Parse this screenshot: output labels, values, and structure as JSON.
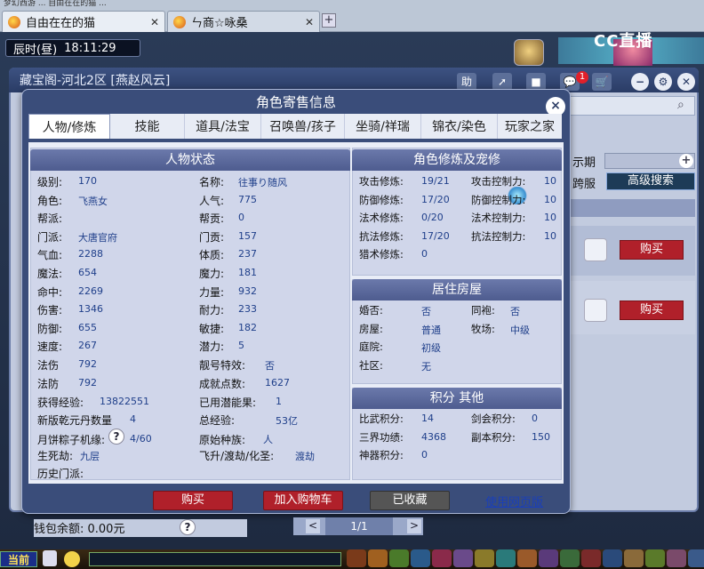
{
  "browser": {
    "top_title": "梦幻西游 ... 自由在在的猫 ...",
    "tabs": [
      {
        "label": "自由在在的猫"
      },
      {
        "label": "ㄣ商☆咏桑"
      }
    ],
    "new_tab": "+"
  },
  "game": {
    "time": "辰时(昼)",
    "clock": "18:11:29",
    "cc_logo": "CC直播"
  },
  "outer_window": {
    "title": "藏宝阁-河北2区 [燕赵风云]",
    "help_btn": "助",
    "badge_count": "1",
    "expiry_label": "示期",
    "plus": "+",
    "cross_server_label": "跨服",
    "advanced_search": "高级搜索",
    "buy_label": "购买",
    "search_icon": "search-icon"
  },
  "modal": {
    "title": "角色寄售信息",
    "close": "×",
    "tabs": [
      "人物/修炼",
      "技能",
      "道具/法宝",
      "召唤兽/孩子",
      "坐骑/祥瑞",
      "锦衣/染色",
      "玩家之家"
    ],
    "active_tab": 0,
    "status": {
      "header": "人物状态",
      "left": [
        {
          "label": "级别:",
          "value": "170"
        },
        {
          "label": "角色:",
          "value": "飞燕女"
        },
        {
          "label": "帮派:",
          "value": ""
        },
        {
          "label": "门派:",
          "value": "大唐官府"
        },
        {
          "label": "气血:",
          "value": "2288"
        },
        {
          "label": "魔法:",
          "value": "654"
        },
        {
          "label": "命中:",
          "value": "2269"
        },
        {
          "label": "伤害:",
          "value": "1346"
        },
        {
          "label": "防御:",
          "value": "655"
        },
        {
          "label": "速度:",
          "value": "267"
        },
        {
          "label": "法伤",
          "value": "792"
        },
        {
          "label": "法防",
          "value": "792"
        }
      ],
      "right": [
        {
          "label": "名称:",
          "value": "往事り随风"
        },
        {
          "label": "人气:",
          "value": "775"
        },
        {
          "label": "帮贡:",
          "value": "0"
        },
        {
          "label": "门贡:",
          "value": "157"
        },
        {
          "label": "体质:",
          "value": "237"
        },
        {
          "label": "魔力:",
          "value": "181"
        },
        {
          "label": "力量:",
          "value": "932"
        },
        {
          "label": "耐力:",
          "value": "233"
        },
        {
          "label": "敏捷:",
          "value": "182"
        },
        {
          "label": "潜力:",
          "value": "5"
        },
        {
          "label": "靓号特效:",
          "value": "否"
        },
        {
          "label": "成就点数:",
          "value": "1627"
        }
      ],
      "exp_label": "获得经验:",
      "exp_value": "13822551",
      "used_potential_label": "已用潜能果:",
      "used_potential_value": "1",
      "qianyuan_label": "新版乾元丹数量",
      "qianyuan_value": "4",
      "total_exp_label": "总经验:",
      "total_exp_value": "53亿",
      "mooncake_label": "月饼粽子机缘:",
      "mooncake_help": "?",
      "mooncake_value": "4/60",
      "race_label": "原始种族:",
      "race_value": "人",
      "life_death_label": "生死劫:",
      "life_death_value": "九层",
      "ascend_label": "飞升/渡劫/化圣:",
      "ascend_value": "渡劫",
      "history_label": "历史门派:"
    },
    "cultivation": {
      "header": "角色修炼及宠修",
      "rows": [
        {
          "l": "攻击修炼:",
          "lv": "19/21",
          "r": "攻击控制力:",
          "rv": "10"
        },
        {
          "l": "防御修炼:",
          "lv": "17/20",
          "r": "防御控制力:",
          "rv": "10"
        },
        {
          "l": "法术修炼:",
          "lv": "0/20",
          "r": "法术控制力:",
          "rv": "10"
        },
        {
          "l": "抗法修炼:",
          "lv": "17/20",
          "r": "抗法控制力:",
          "rv": "10"
        },
        {
          "l": "猎术修炼:",
          "lv": "0",
          "r": "",
          "rv": ""
        }
      ]
    },
    "house": {
      "header": "居住房屋",
      "rows": [
        {
          "l": "婚否:",
          "lv": "否",
          "r": "同袍:",
          "rv": "否"
        },
        {
          "l": "房屋:",
          "lv": "普通",
          "r": "牧场:",
          "rv": "中级"
        },
        {
          "l": "庭院:",
          "lv": "初级",
          "r": "",
          "rv": ""
        },
        {
          "l": "社区:",
          "lv": "无",
          "r": "",
          "rv": ""
        }
      ]
    },
    "points": {
      "header": "积分 其他",
      "rows": [
        {
          "l": "比武积分:",
          "lv": "14",
          "r": "剑会积分:",
          "rv": "0"
        },
        {
          "l": "三界功绩:",
          "lv": "4368",
          "r": "副本积分:",
          "rv": "150"
        },
        {
          "l": "神器积分:",
          "lv": "0",
          "r": "",
          "rv": ""
        }
      ]
    },
    "buttons": {
      "buy": "购买",
      "add_cart": "加入购物车",
      "collected": "已收藏",
      "web_version": "使用网页版"
    }
  },
  "footer": {
    "wallet": "钱包余额: 0.00元",
    "help": "?",
    "page": "1/1",
    "prev": "<",
    "next": ">",
    "current": "当前"
  },
  "colors": {
    "buy_button": "#b0202a",
    "header_blue": "#4e5c8f",
    "value_blue": "#1f3f8a",
    "adv_search_bg": "#1d3b57"
  }
}
